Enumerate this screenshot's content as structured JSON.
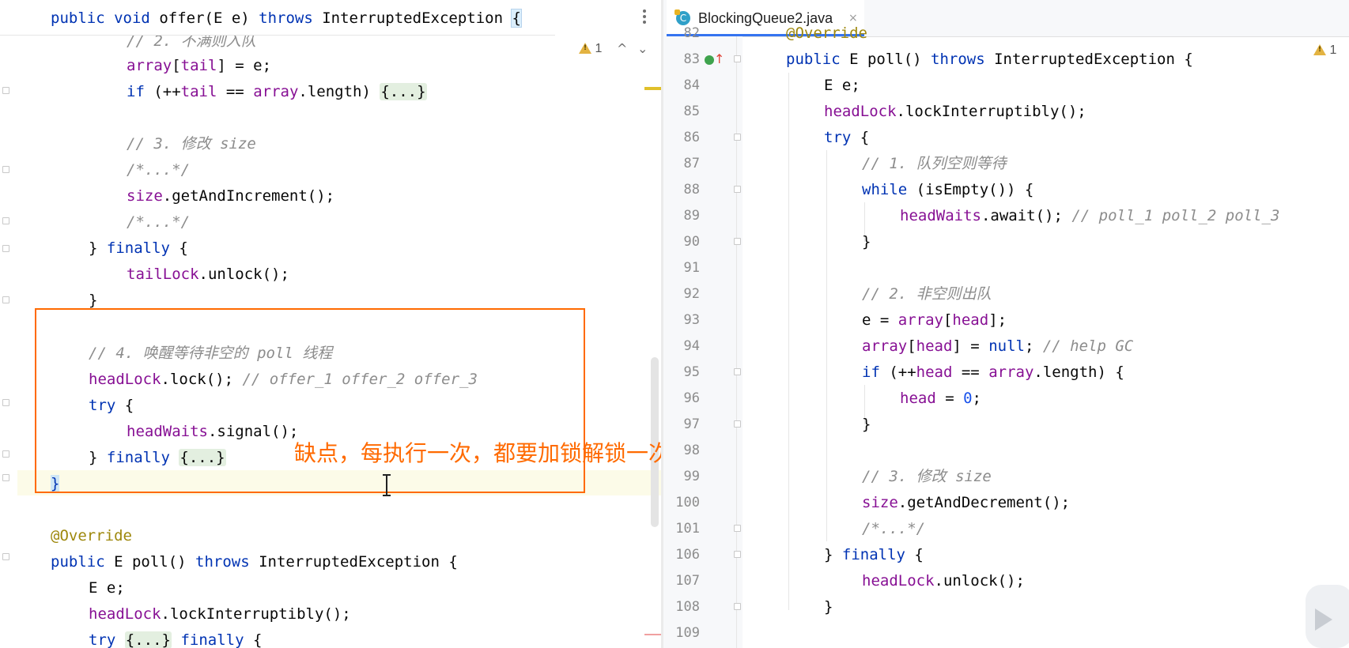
{
  "left_editor": {
    "sticky_line": {
      "kw1": "public",
      "kw2": "void",
      "name": "offer",
      "params_open": "(E e) ",
      "kw3": "throws",
      "exc": " InterruptedException ",
      "brace": "{"
    },
    "inspection": {
      "count": "1",
      "up": "^",
      "down": "⌄"
    },
    "lines": {
      "l0_comment": "// 2. 不满则入队",
      "l1_fld": "array",
      "l1_rest_a": "[",
      "l1_fld2": "tail",
      "l1_rest_b": "] = e;",
      "l2_kw": "if",
      "l2_rest_a": " (++",
      "l2_fld": "tail",
      "l2_rest_b": " == ",
      "l2_fld2": "array",
      "l2_rest_c": ".length) ",
      "l2_fold": "{...}",
      "l3_comment": "// 3. 修改 size",
      "l4_comment": "/*...*/",
      "l5_fld": "size",
      "l5_rest": ".getAndIncrement();",
      "l6_comment": "/*...*/",
      "l7_a": "} ",
      "l7_kw": "finally",
      "l7_b": " {",
      "l8_fld": "tailLock",
      "l8_rest": ".unlock();",
      "l9": "}",
      "l10_comment": "// 4. 唤醒等待非空的 poll 线程",
      "l11_fld": "headLock",
      "l11_rest": ".lock(); ",
      "l11_comment": "// offer_1 offer_2 offer_3",
      "l12_kw": "try",
      "l12_rest": " {",
      "l13_fld": "headWaits",
      "l13_rest": ".signal();",
      "l14_a": "} ",
      "l14_kw": "finally",
      "l14_b": " ",
      "l14_fold": "{...}",
      "l15": "}",
      "l16_ann": "@Override",
      "l17_kw1": "public",
      "l17_a": " E poll() ",
      "l17_kw2": "throws",
      "l17_b": " InterruptedException {",
      "l18_a": "E e;",
      "l19_fld": "headLock",
      "l19_rest": ".lockInterruptibly();",
      "l20_kw": "try",
      "l20_b": " ",
      "l20_fold": "{...}",
      "l20_c": " ",
      "l20_kw2": "finally",
      "l20_d": " {"
    },
    "annotation_text": "缺点，每执行一次，都要加锁解锁一次，效率较低"
  },
  "right_editor": {
    "tab": {
      "icon": "C",
      "label": "BlockingQueue2.java",
      "close": "×"
    },
    "inspection": {
      "count": "1"
    },
    "line_numbers": [
      "82",
      "83",
      "84",
      "85",
      "86",
      "87",
      "88",
      "89",
      "90",
      "91",
      "92",
      "93",
      "94",
      "95",
      "96",
      "97",
      "98",
      "99",
      "100",
      "101",
      "106",
      "107",
      "108",
      "109"
    ],
    "lines": {
      "r0": "@Override",
      "r1_kw1": "public",
      "r1_a": " E poll() ",
      "r1_kw2": "throws",
      "r1_b": " InterruptedException {",
      "r2": "E e;",
      "r3_fld": "headLock",
      "r3_rest": ".lockInterruptibly();",
      "r4_kw": "try",
      "r4_rest": " {",
      "r5_comment": "// 1. 队列空则等待",
      "r6_kw": "while",
      "r6_rest": " (isEmpty()) {",
      "r7_fld": "headWaits",
      "r7_rest": ".await(); ",
      "r7_comment": "// poll_1 poll_2 poll_3",
      "r8": "}",
      "r10_comment": "// 2. 非空则出队",
      "r11_a": "e = ",
      "r11_fld": "array",
      "r11_b": "[",
      "r11_fld2": "head",
      "r11_c": "];",
      "r12_fld": "array",
      "r12_a": "[",
      "r12_fld2": "head",
      "r12_b": "] = ",
      "r12_kw": "null",
      "r12_c": "; ",
      "r12_comment": "// help GC",
      "r13_kw": "if",
      "r13_a": " (++",
      "r13_fld": "head",
      "r13_b": " == ",
      "r13_fld2": "array",
      "r13_c": ".length) {",
      "r14_fld": "head",
      "r14_a": " = ",
      "r14_num": "0",
      "r14_b": ";",
      "r15": "}",
      "r17_comment": "// 3. 修改 size",
      "r18_fld": "size",
      "r18_rest": ".getAndDecrement();",
      "r19_comment": "/*...*/",
      "r20_a": "} ",
      "r20_kw": "finally",
      "r20_b": " {",
      "r21_fld": "headLock",
      "r21_rest": ".unlock();",
      "r22": "}"
    }
  },
  "colors": {
    "annotation_orange": "#ff6a00",
    "keyword": "#0033b3",
    "field": "#871094",
    "comment": "#8c8c8c",
    "annotation": "#9e880d"
  }
}
